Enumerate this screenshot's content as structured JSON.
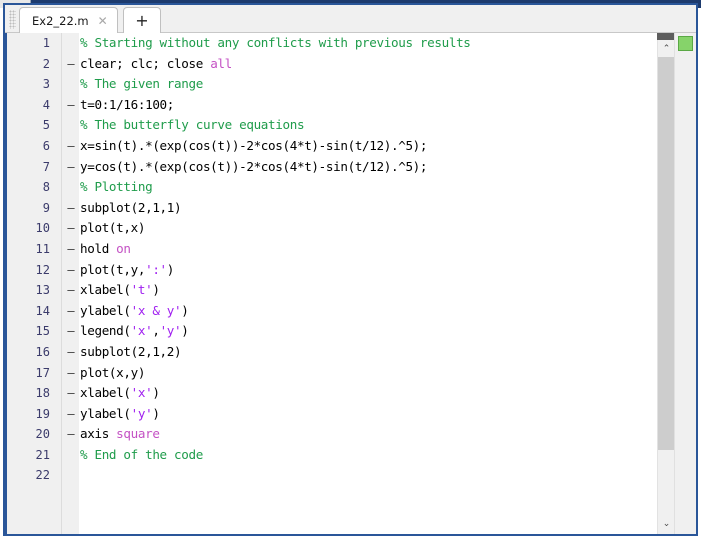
{
  "window": {
    "frame_color": "#2a5699",
    "titlebar_color": "#1d3b6e"
  },
  "tabbar": {
    "file_tab_label": "Ex2_22.m",
    "close_glyph": "✕",
    "new_tab_glyph": "+"
  },
  "editor": {
    "syntax_colors": {
      "comment": "#1f9c4b",
      "keyword": "#c452c4",
      "string": "#a020f0",
      "plain": "#000000",
      "line_number": "#3b3b6b"
    },
    "lines": [
      {
        "n": "1",
        "dash": "",
        "tokens": [
          {
            "t": "% Starting without any conflicts with previous results",
            "c": "comment"
          }
        ]
      },
      {
        "n": "2",
        "dash": "–",
        "tokens": [
          {
            "t": "clear; clc; close ",
            "c": "plain"
          },
          {
            "t": "all",
            "c": "keyword"
          }
        ]
      },
      {
        "n": "3",
        "dash": "",
        "tokens": [
          {
            "t": "% The given range",
            "c": "comment"
          }
        ]
      },
      {
        "n": "4",
        "dash": "–",
        "tokens": [
          {
            "t": "t=0:1/16:100;",
            "c": "plain"
          }
        ]
      },
      {
        "n": "5",
        "dash": "",
        "tokens": [
          {
            "t": "% The butterfly curve equations",
            "c": "comment"
          }
        ]
      },
      {
        "n": "6",
        "dash": "–",
        "tokens": [
          {
            "t": "x=sin(t).*(exp(cos(t))-2*cos(4*t)-sin(t/12).^5);",
            "c": "plain"
          }
        ]
      },
      {
        "n": "7",
        "dash": "–",
        "tokens": [
          {
            "t": "y=cos(t).*(exp(cos(t))-2*cos(4*t)-sin(t/12).^5);",
            "c": "plain"
          }
        ]
      },
      {
        "n": "8",
        "dash": "",
        "tokens": [
          {
            "t": "% Plotting",
            "c": "comment"
          }
        ]
      },
      {
        "n": "9",
        "dash": "–",
        "tokens": [
          {
            "t": "subplot(2,1,1)",
            "c": "plain"
          }
        ]
      },
      {
        "n": "10",
        "dash": "–",
        "tokens": [
          {
            "t": "plot(t,x)",
            "c": "plain"
          }
        ]
      },
      {
        "n": "11",
        "dash": "–",
        "tokens": [
          {
            "t": "hold ",
            "c": "plain"
          },
          {
            "t": "on",
            "c": "keyword"
          }
        ]
      },
      {
        "n": "12",
        "dash": "–",
        "tokens": [
          {
            "t": "plot(t,y,",
            "c": "plain"
          },
          {
            "t": "':'",
            "c": "string"
          },
          {
            "t": ")",
            "c": "plain"
          }
        ]
      },
      {
        "n": "13",
        "dash": "–",
        "tokens": [
          {
            "t": "xlabel(",
            "c": "plain"
          },
          {
            "t": "'t'",
            "c": "string"
          },
          {
            "t": ")",
            "c": "plain"
          }
        ]
      },
      {
        "n": "14",
        "dash": "–",
        "tokens": [
          {
            "t": "ylabel(",
            "c": "plain"
          },
          {
            "t": "'x & y'",
            "c": "string"
          },
          {
            "t": ")",
            "c": "plain"
          }
        ]
      },
      {
        "n": "15",
        "dash": "–",
        "tokens": [
          {
            "t": "legend(",
            "c": "plain"
          },
          {
            "t": "'x'",
            "c": "string"
          },
          {
            "t": ",",
            "c": "plain"
          },
          {
            "t": "'y'",
            "c": "string"
          },
          {
            "t": ")",
            "c": "plain"
          }
        ]
      },
      {
        "n": "16",
        "dash": "–",
        "tokens": [
          {
            "t": "subplot(2,1,2)",
            "c": "plain"
          }
        ]
      },
      {
        "n": "17",
        "dash": "–",
        "tokens": [
          {
            "t": "plot(x,y)",
            "c": "plain"
          }
        ]
      },
      {
        "n": "18",
        "dash": "–",
        "tokens": [
          {
            "t": "xlabel(",
            "c": "plain"
          },
          {
            "t": "'x'",
            "c": "string"
          },
          {
            "t": ")",
            "c": "plain"
          }
        ]
      },
      {
        "n": "19",
        "dash": "–",
        "tokens": [
          {
            "t": "ylabel(",
            "c": "plain"
          },
          {
            "t": "'y'",
            "c": "string"
          },
          {
            "t": ")",
            "c": "plain"
          }
        ]
      },
      {
        "n": "20",
        "dash": "–",
        "tokens": [
          {
            "t": "axis ",
            "c": "plain"
          },
          {
            "t": "square",
            "c": "keyword"
          }
        ]
      },
      {
        "n": "21",
        "dash": "",
        "tokens": [
          {
            "t": "% End of the code",
            "c": "comment"
          }
        ]
      },
      {
        "n": "22",
        "dash": "",
        "tokens": [
          {
            "t": "",
            "c": "plain"
          }
        ]
      }
    ]
  },
  "scrollbar": {
    "up_arrow": "⌃",
    "down_arrow": "⌄"
  },
  "status": {
    "indicator_color": "#86d36a",
    "indicator_meaning": "code-analyzer-ok"
  }
}
